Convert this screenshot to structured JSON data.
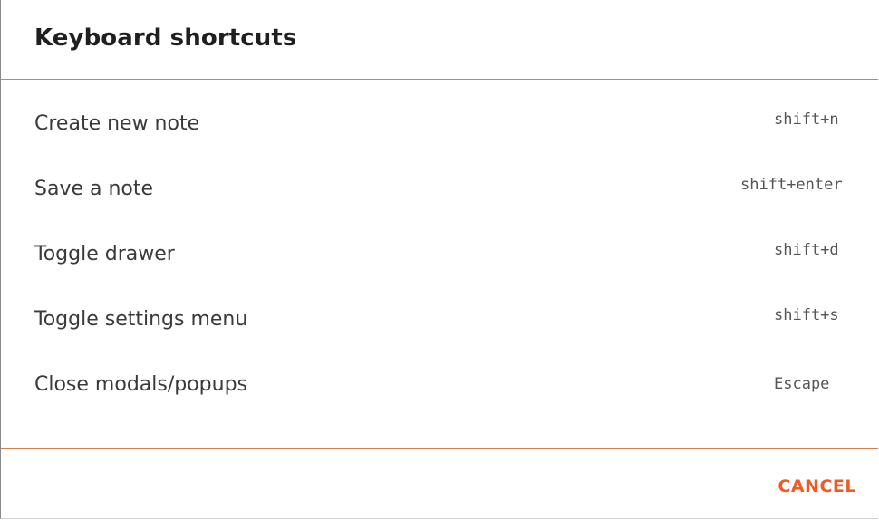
{
  "dialog": {
    "title": "Keyboard shortcuts"
  },
  "shortcuts": [
    {
      "label": "Create new note",
      "keys": "shift+n"
    },
    {
      "label": "Save a note",
      "keys": "shift+enter"
    },
    {
      "label": "Toggle drawer",
      "keys": "shift+d"
    },
    {
      "label": "Toggle settings menu",
      "keys": "shift+s"
    },
    {
      "label": "Close modals/popups",
      "keys": "Escape"
    }
  ],
  "footer": {
    "cancel_label": "CANCEL"
  },
  "colors": {
    "accent": "#f15a22",
    "divider": "#d2804f",
    "title_text": "#1f1f1f",
    "body_text": "#3a3a3a"
  }
}
